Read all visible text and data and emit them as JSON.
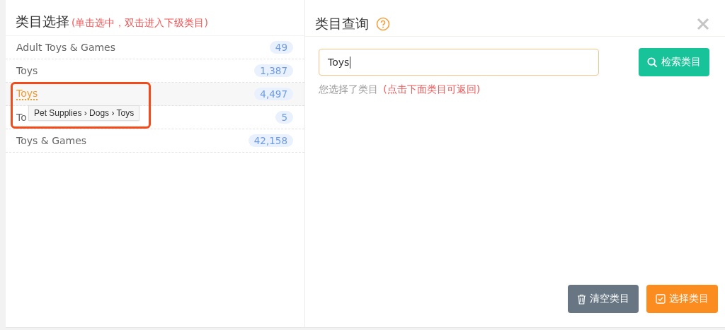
{
  "left": {
    "title": "类目选择",
    "hint": "(单击选中，双击进入下级类目)",
    "rows": [
      {
        "label": "Adult Toys & Games",
        "count": "49",
        "selected": false
      },
      {
        "label": "Toys",
        "count": "1,387",
        "selected": false
      },
      {
        "label": "Toys",
        "count": "4,497",
        "selected": true
      },
      {
        "label": "To",
        "count": "5",
        "selected": false
      },
      {
        "label": "Toys & Games",
        "count": "42,158",
        "selected": false
      }
    ],
    "tooltip": "Pet Supplies › Dogs › Toys"
  },
  "right": {
    "title": "类目查询",
    "search": {
      "value": "Toys"
    },
    "search_button": "检索类目",
    "chosen_label": "您选择了类目",
    "chosen_hint": "(点击下面类目可返回)",
    "buttons": [
      {
        "label": "清空类目",
        "kind": "clear"
      },
      {
        "label": "选择类目",
        "kind": "select"
      }
    ]
  }
}
